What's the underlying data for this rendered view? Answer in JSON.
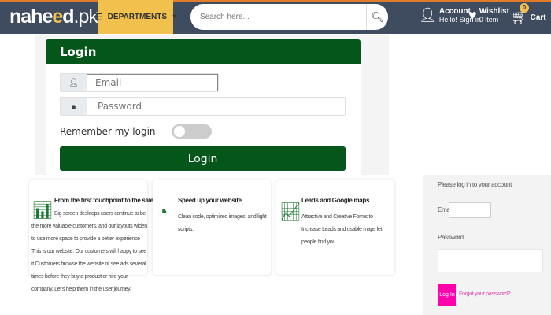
{
  "header": {
    "logo": "nahe",
    "logo_mid": "e",
    "logo_tail": "d",
    "logo_pk": ".pk",
    "departments": "DEPARTMENTS",
    "search_placeholder": "Search here...",
    "account_title": "Account",
    "account_sub": "Hello! Sign in",
    "wishlist_title": "Wishlist",
    "wishlist_sub": "0 item",
    "cart_label": "Cart",
    "cart_count": "0"
  },
  "login": {
    "title": "Login",
    "email_placeholder": "Email",
    "password_placeholder": "Password",
    "remember": "Remember my login",
    "remember_on": false,
    "button": "Login"
  },
  "features": [
    {
      "title": "From the first touchpoint to the sale",
      "desc": "Big screen desktops users continue to be the more valuable customers, and our layouts widen to use more space to provide a better experience This is our website. Our customers will happy to see it Customers browse the website or see ads several times before they buy a product or hire your company. Let's help them in the user journey."
    },
    {
      "title": "Speed up your website",
      "desc": "Clean code, optimized images, and light scripts."
    },
    {
      "title": "Leads and Google maps",
      "desc": "Attractive and Creative Forms to Increase Leads and usable maps let people find you."
    }
  ],
  "side_login": {
    "prompt": "Please log in to your account",
    "email_label": "Email",
    "password_label": "Password",
    "button": "Log In",
    "forgot": "Forgot your password?"
  },
  "colors": {
    "header": "#3f4b5e",
    "accent": "#f2c04c",
    "green": "#04561a",
    "pink": "#ff00aa"
  }
}
